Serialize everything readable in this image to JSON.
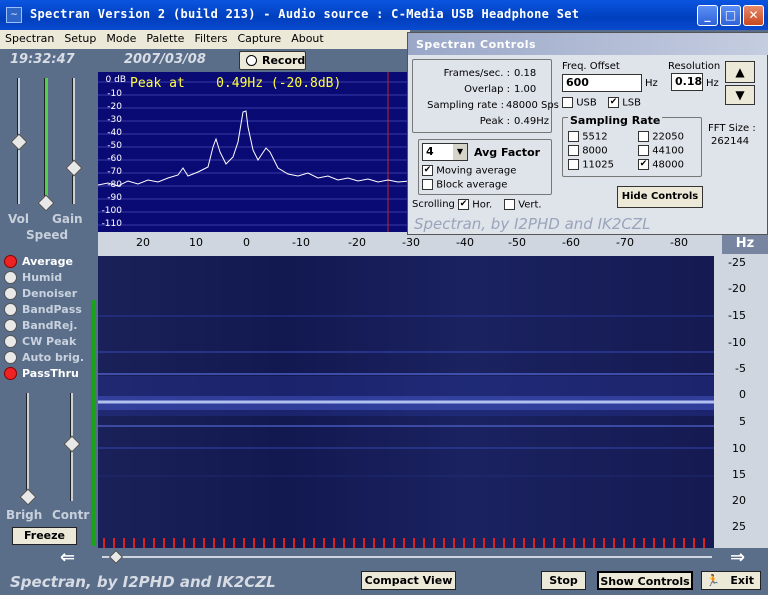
{
  "window": {
    "title": "Spectran Version 2  (build 213) - Audio source  :  C-Media USB Headphone Set",
    "minimize": "_",
    "maximize": "□",
    "close": "✕",
    "app_icon": "~"
  },
  "menu": [
    "Spectran",
    "Setup",
    "Mode",
    "Palette",
    "Filters",
    "Capture",
    "About"
  ],
  "status": {
    "time": "19:32:47",
    "date": "2007/03/08",
    "record_label": "Record"
  },
  "spectrum": {
    "peak_label": "Peak at",
    "peak_value": "0.49Hz (-20.8dB)",
    "y_ticks": [
      "0 dB",
      "-10",
      "-20",
      "-30",
      "-40",
      "-50",
      "-60",
      "-70",
      "-80",
      "-90",
      "-100",
      "-110"
    ]
  },
  "freq_axis": {
    "ticks": [
      "20",
      "10",
      "0",
      "-10",
      "-20",
      "-30",
      "-40",
      "-50",
      "-60",
      "-70",
      "-80"
    ],
    "unit": "Hz"
  },
  "waterfall_axis": [
    "-25",
    "-20",
    "-15",
    "-10",
    "-5",
    "0",
    "5",
    "10",
    "15",
    "20",
    "25"
  ],
  "left_panel": {
    "vol_label": "Vol",
    "gain_label": "Gain",
    "speed_label": "Speed",
    "brigh_label": "Brigh",
    "contr_label": "Contr",
    "freeze_label": "Freeze",
    "options": [
      {
        "label": "Average",
        "on": true
      },
      {
        "label": "Humid",
        "on": false
      },
      {
        "label": "Denoiser",
        "on": false
      },
      {
        "label": "BandPass",
        "on": false
      },
      {
        "label": "BandRej.",
        "on": false
      },
      {
        "label": "CW Peak",
        "on": false
      },
      {
        "label": "Auto brig.",
        "on": false
      },
      {
        "label": "PassThru",
        "on": true
      }
    ]
  },
  "controls": {
    "title": "Spectran Controls",
    "frames_label": "Frames/sec. :",
    "frames_value": "0.18",
    "overlap_label": "Overlap :",
    "overlap_value": "1.00",
    "sampling_label": "Sampling rate :",
    "sampling_value": "48000 Sps",
    "peak_label": "Peak :",
    "peak_value": "0.49Hz",
    "avg_value": "4",
    "avg_label": "Avg Factor",
    "moving_avg": "Moving average",
    "block_avg": "Block average",
    "scrolling_label": "Scrolling",
    "hor_label": "Hor.",
    "vert_label": "Vert.",
    "freq_offset_label": "Freq. Offset",
    "freq_offset_value": "600",
    "hz": "Hz",
    "resolution_label": "Resolution",
    "resolution_value": "0.18",
    "usb_label": "USB",
    "lsb_label": "LSB",
    "sampling_rate_title": "Sampling Rate",
    "rates": [
      "5512",
      "8000",
      "11025",
      "22050",
      "44100",
      "48000"
    ],
    "fft_label": "FFT Size :",
    "fft_value": "262144",
    "hide_label": "Hide Controls",
    "brand": "Spectran, by I2PHD and IK2CZL",
    "up": "▲",
    "down": "▼",
    "check": "✔"
  },
  "bottom": {
    "brand": "Spectran, by I2PHD and IK2CZL",
    "compact_label": "Compact View",
    "stop_label": "Stop",
    "show_controls_label": "Show Controls",
    "exit_label": "Exit",
    "left_arrow": "⇐",
    "right_arrow": "⇒",
    "exit_icon": "🏃"
  }
}
